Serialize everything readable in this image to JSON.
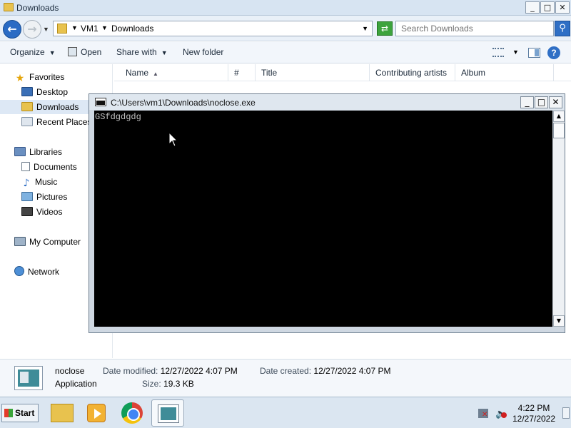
{
  "explorer": {
    "title": "Downloads",
    "window_buttons": [
      "_",
      "□",
      "✕"
    ],
    "address": {
      "crumbs": [
        "VM1",
        "Downloads"
      ],
      "search_placeholder": "Search Downloads"
    },
    "toolbar": {
      "organize": "Organize",
      "open": "Open",
      "share_with": "Share with",
      "new_folder": "New folder",
      "help": "?"
    },
    "nav": {
      "favorites": "Favorites",
      "desktop": "Desktop",
      "downloads": "Downloads",
      "recent_places": "Recent Places",
      "libraries": "Libraries",
      "documents": "Documents",
      "music": "Music",
      "pictures": "Pictures",
      "videos": "Videos",
      "my_computer": "My Computer",
      "network": "Network"
    },
    "columns": {
      "name": "Name",
      "number": "#",
      "title": "Title",
      "contributing_artists": "Contributing artists",
      "album": "Album"
    },
    "details": {
      "name": "noclose",
      "type": "Application",
      "modified_label": "Date modified:",
      "modified_value": "12/27/2022 4:07 PM",
      "created_label": "Date created:",
      "created_value": "12/27/2022 4:07 PM",
      "size_label": "Size:",
      "size_value": "19.3 KB"
    }
  },
  "console": {
    "title": "C:\\Users\\vm1\\Downloads\\noclose.exe",
    "output": "GSfdgdgdg",
    "buttons": [
      "_",
      "□",
      "✕"
    ]
  },
  "taskbar": {
    "start": "Start",
    "items": [
      "windows-explorer",
      "media-player",
      "chrome",
      "console"
    ],
    "clock_time": "4:22 PM",
    "clock_date": "12/27/2022"
  }
}
